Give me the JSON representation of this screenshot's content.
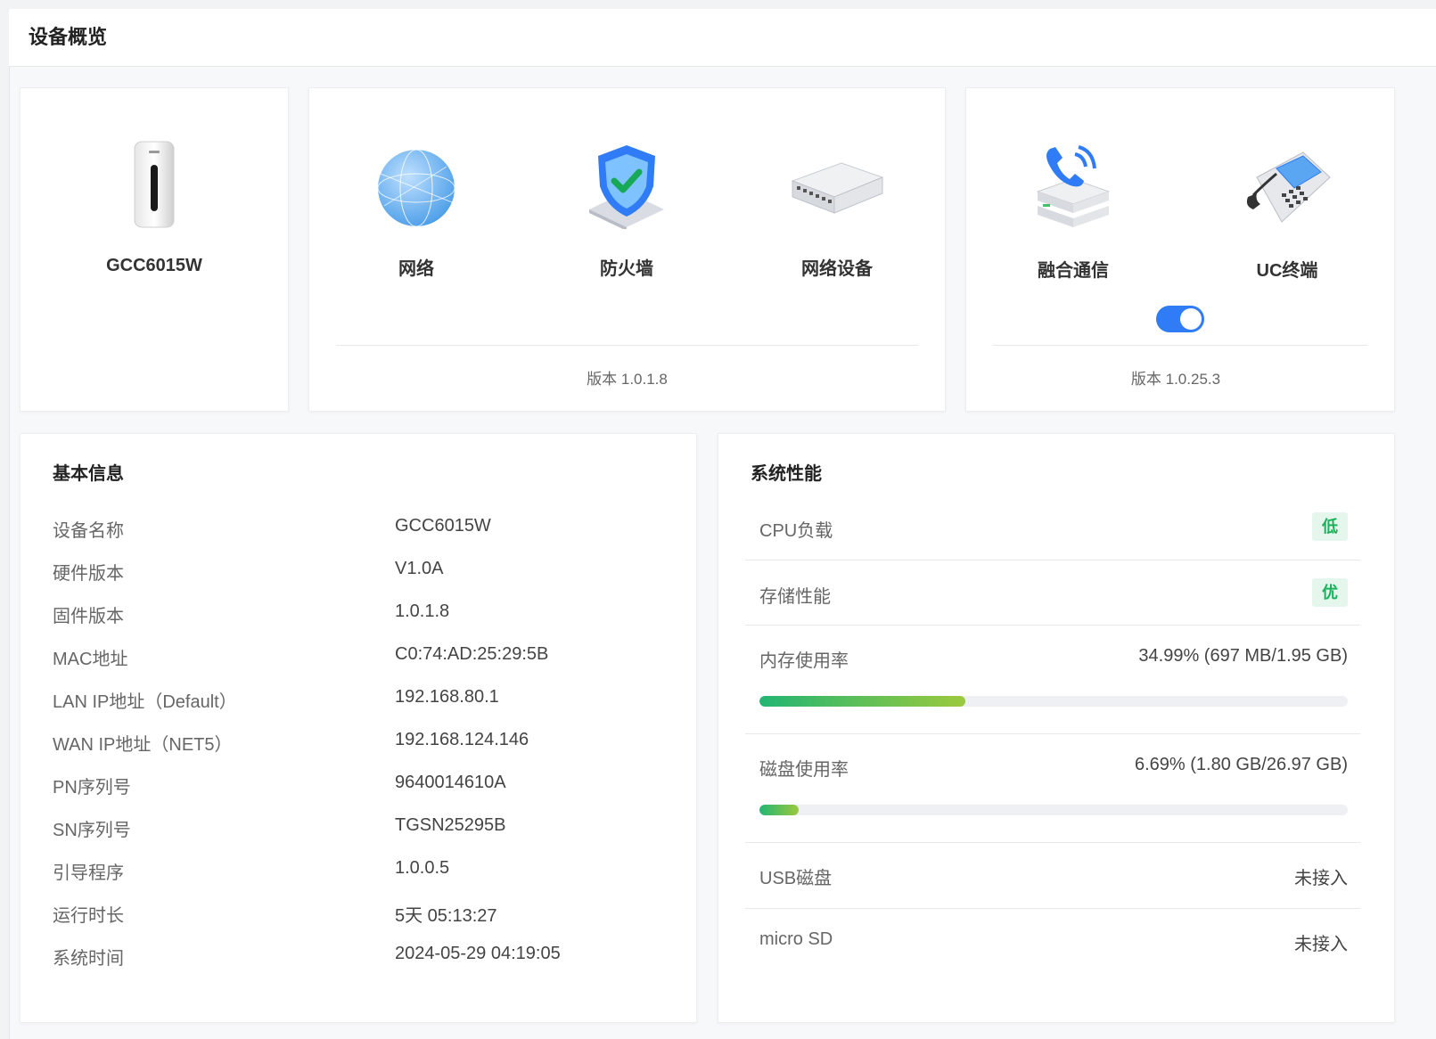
{
  "page": {
    "title": "设备概览"
  },
  "device_card": {
    "name": "GCC6015W",
    "icon": "router-device-icon"
  },
  "network_card": {
    "items": [
      {
        "label": "网络",
        "icon": "globe-icon"
      },
      {
        "label": "防火墙",
        "icon": "shield-icon"
      },
      {
        "label": "网络设备",
        "icon": "switch-icon"
      }
    ],
    "version": "版本 1.0.1.8"
  },
  "uc_card": {
    "items": [
      {
        "label": "融合通信",
        "icon": "phone-server-icon"
      },
      {
        "label": "UC终端",
        "icon": "desk-phone-icon"
      }
    ],
    "toggle_on": true,
    "version": "版本 1.0.25.3"
  },
  "basic_info": {
    "title": "基本信息",
    "rows": [
      {
        "key": "设备名称",
        "value": "GCC6015W"
      },
      {
        "key": "硬件版本",
        "value": "V1.0A"
      },
      {
        "key": "固件版本",
        "value": "1.0.1.8"
      },
      {
        "key": "MAC地址",
        "value": "C0:74:AD:25:29:5B"
      },
      {
        "key": "LAN IP地址（Default）",
        "value": "192.168.80.1"
      },
      {
        "key": "WAN IP地址（NET5）",
        "value": "192.168.124.146"
      },
      {
        "key": "PN序列号",
        "value": "9640014610A"
      },
      {
        "key": "SN序列号",
        "value": "TGSN25295B"
      },
      {
        "key": "引导程序",
        "value": "1.0.0.5"
      },
      {
        "key": "运行时长",
        "value": "5天 05:13:27"
      },
      {
        "key": "系统时间",
        "value": "2024-05-29 04:19:05"
      }
    ]
  },
  "performance": {
    "title": "系统性能",
    "cpu": {
      "label": "CPU负载",
      "status": "低"
    },
    "storage": {
      "label": "存储性能",
      "status": "优"
    },
    "memory": {
      "label": "内存使用率",
      "value": "34.99% (697 MB/1.95 GB)",
      "percent": 34.99
    },
    "disk": {
      "label": "磁盘使用率",
      "value": "6.69% (1.80 GB/26.97 GB)",
      "percent": 6.69
    },
    "usb": {
      "label": "USB磁盘",
      "value": "未接入"
    },
    "sd": {
      "label": "micro SD",
      "value": "未接入"
    }
  },
  "colors": {
    "accent": "#2f7cf6",
    "good": "#19b25b",
    "badge_bg": "#e5f7ec"
  }
}
